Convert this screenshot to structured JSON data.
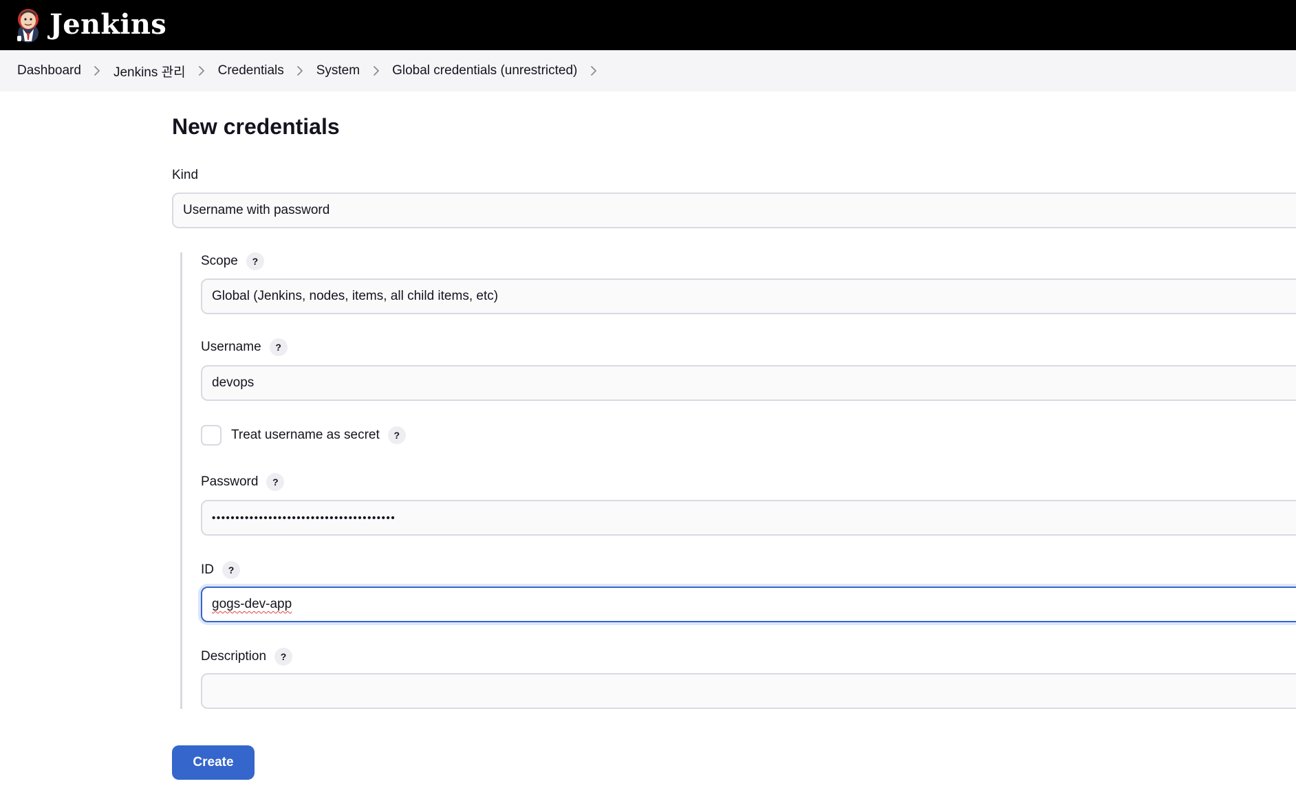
{
  "header": {
    "brand": "Jenkins",
    "logo_icon": "jenkins-butler-icon"
  },
  "breadcrumb": [
    "Dashboard",
    "Jenkins 관리",
    "Credentials",
    "System",
    "Global credentials (unrestricted)"
  ],
  "form": {
    "title": "New credentials",
    "kind": {
      "label": "Kind",
      "value": "Username with password"
    },
    "scope": {
      "label": "Scope",
      "value": "Global (Jenkins, nodes, items, all child items, etc)",
      "help": "?"
    },
    "username": {
      "label": "Username",
      "value": "devops",
      "help": "?"
    },
    "treat_secret": {
      "label": "Treat username as secret",
      "checked": false,
      "help": "?"
    },
    "password": {
      "label": "Password",
      "masked": "•••••••••••••••••••••••••••••••••••••••",
      "help": "?"
    },
    "id": {
      "label": "ID",
      "value": "gogs-dev-app",
      "help": "?"
    },
    "description": {
      "label": "Description",
      "value": "",
      "help": "?"
    },
    "create_label": "Create"
  },
  "colors": {
    "header_bg": "#000000",
    "breadcrumb_bg": "#f5f5f7",
    "accent": "#3466cc",
    "border": "#d9d9e1"
  }
}
